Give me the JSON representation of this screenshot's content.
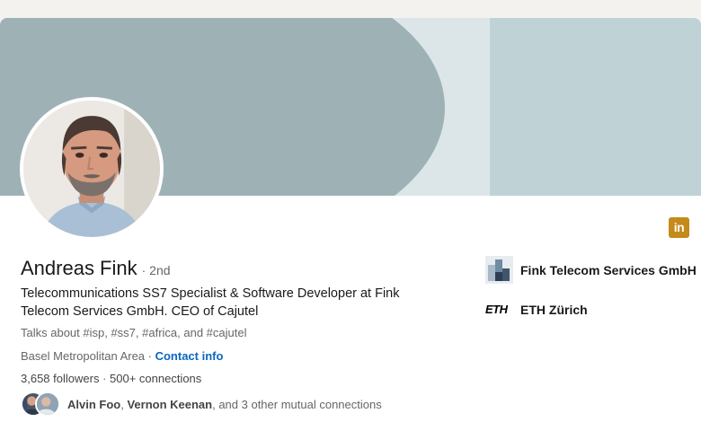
{
  "profile": {
    "name": "Andreas Fink",
    "degree": "· 2nd",
    "headline": "Telecommunications SS7 Specialist & Software Developer at Fink Telecom Services GmbH. CEO of Cajutel",
    "talks_about": "Talks about #isp, #ss7, #africa, and #cajutel",
    "location": "Basel Metropolitan Area",
    "location_sep": " · ",
    "contact_info_label": "Contact info",
    "followers": "3,658 followers",
    "stats_sep": " · ",
    "connections": "500+ connections"
  },
  "mutual": {
    "name1": "Alvin Foo",
    "sep1": ", ",
    "name2": "Vernon Keenan",
    "rest": ", and 3 other mutual connections"
  },
  "organizations": [
    {
      "name": "Fink Telecom Services GmbH",
      "icon": "company-logo"
    },
    {
      "name": "ETH Zürich",
      "logo_text": "ETH",
      "icon": "school-logo"
    }
  ],
  "badge": {
    "text": "in",
    "icon": "linkedin-icon",
    "color": "#c48a1a"
  },
  "colors": {
    "link": "#0a66c2",
    "banner_dark": "#9eb2b6",
    "banner_light": "#bfd3d6"
  }
}
